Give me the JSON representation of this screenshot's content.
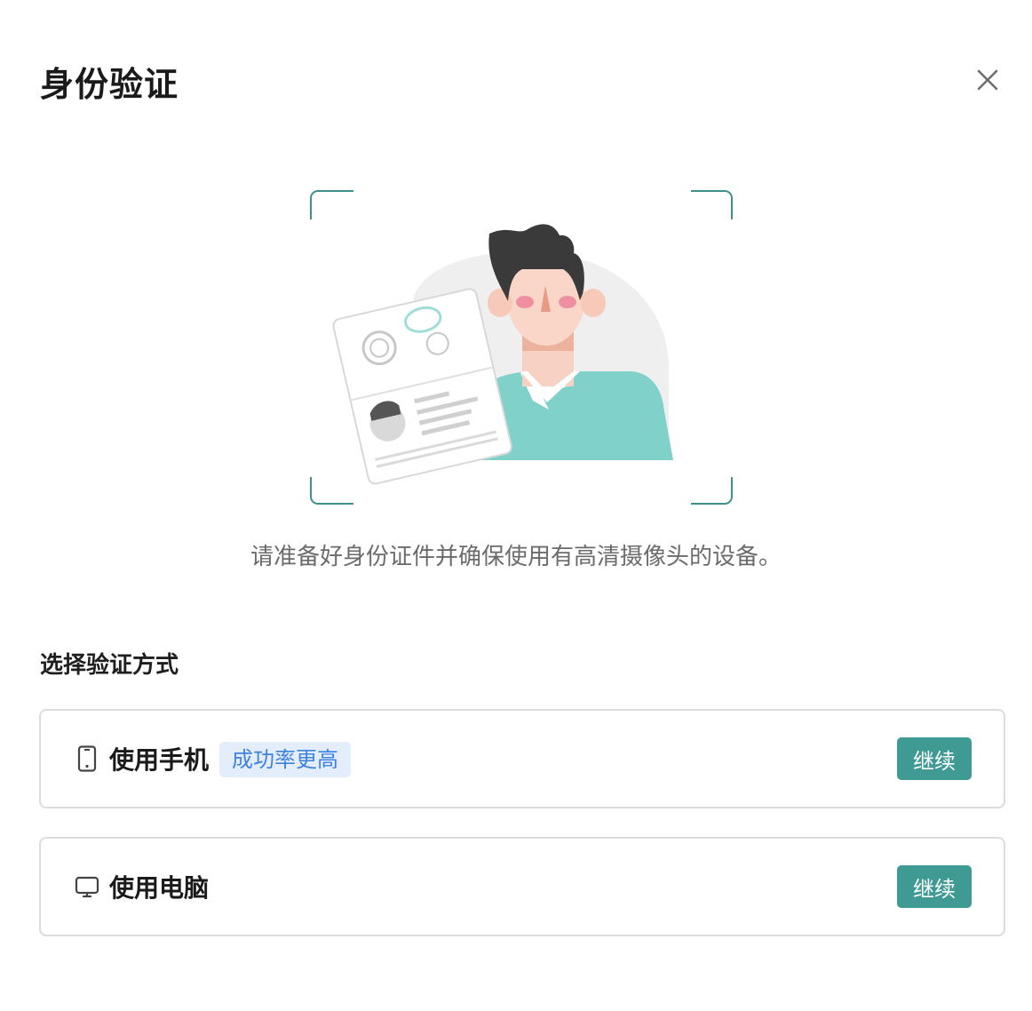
{
  "dialog": {
    "title": "身份验证",
    "close_icon": "close-icon"
  },
  "illustration": {
    "icon": "person-holding-id-illustration"
  },
  "instruction": "请准备好身份证件并确保使用有高清摄像头的设备。",
  "methods": {
    "section_label": "选择验证方式",
    "options": [
      {
        "icon": "smartphone-icon",
        "label": "使用手机",
        "badge": "成功率更高",
        "button": "继续"
      },
      {
        "icon": "monitor-icon",
        "label": "使用电脑",
        "button": "继续"
      }
    ]
  },
  "colors": {
    "accent": "#3f9a94",
    "badge_bg": "#e4edfb",
    "badge_text": "#3f83e0"
  }
}
